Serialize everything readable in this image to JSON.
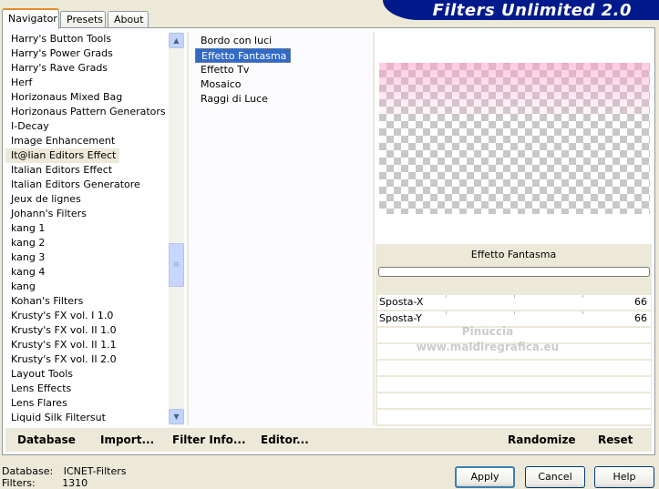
{
  "tabs": [
    "Navigator",
    "Presets",
    "About"
  ],
  "active_tab": "Navigator",
  "banner_title": "Filters Unlimited 2.0",
  "categories": [
    "Harry's Button Tools",
    "Harry's Power Grads",
    "Harry's Rave Grads",
    "Herf",
    "Horizonaus Mixed Bag",
    "Horizonaus Pattern Generators",
    "I-Decay",
    "Image Enhancement",
    "It@lian Editors Effect",
    "Italian Editors Effect",
    "Italian Editors Generatore",
    "Jeux de lignes",
    "Johann's Filters",
    "kang 1",
    "kang 2",
    "kang 3",
    "kang 4",
    "kang",
    "Kohan's Filters",
    "Krusty's FX vol. I 1.0",
    "Krusty's FX vol. II 1.0",
    "Krusty's FX vol. II 1.1",
    "Krusty's FX vol. II 2.0",
    "Layout Tools",
    "Lens Effects",
    "Lens Flares",
    "Liquid Silk Filtersut"
  ],
  "selected_category": "It@lian Editors Effect",
  "filters": [
    "Bordo con luci",
    "Effetto Fantasma",
    "Effetto Tv",
    "Mosaico",
    "Raggi di Luce"
  ],
  "selected_filter": "Effetto Fantasma",
  "preview": {
    "filter_title": "Effetto Fantasma",
    "params": [
      {
        "label": "Sposta-X",
        "value": "66"
      },
      {
        "label": "Sposta-Y",
        "value": "66"
      }
    ],
    "watermark_line1": "Pinuccia",
    "watermark_line2": "www.maldiregrafica.eu"
  },
  "actions": {
    "database": "Database",
    "import": "Import...",
    "filter_info": "Filter Info...",
    "editor": "Editor...",
    "randomize": "Randomize",
    "reset": "Reset"
  },
  "status": {
    "database_label": "Database:",
    "database_value": "ICNET-Filters",
    "filters_label": "Filters:",
    "filters_value": "1310"
  },
  "buttons": {
    "apply": "Apply",
    "cancel": "Cancel",
    "help": "Help"
  },
  "colors": {
    "banner": "#001a8c",
    "selection": "#316ac5",
    "panel": "#ece9d8"
  }
}
